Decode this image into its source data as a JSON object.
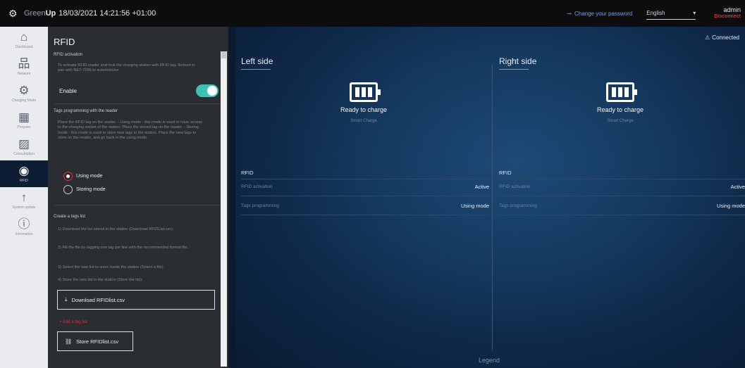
{
  "topbar": {
    "brand_prefix": "Green",
    "brand_bold": "Up",
    "datetime": "18/03/2021 14:21:56 +01:00",
    "change_password": "Change your password",
    "language": "English",
    "user": "admin",
    "logout": "Disconnect"
  },
  "nav": {
    "items": [
      {
        "label": "Dashboard",
        "icon": "home-icon"
      },
      {
        "label": "Network",
        "icon": "network-icon"
      },
      {
        "label": "Charging Mode",
        "icon": "gear-icon"
      },
      {
        "label": "Program",
        "icon": "calendar-icon"
      },
      {
        "label": "Consumption",
        "icon": "chart-icon"
      },
      {
        "label": "RFID",
        "icon": "rfid-badge-icon"
      },
      {
        "label": "System update",
        "icon": "arrow-up-icon"
      },
      {
        "label": "Information",
        "icon": "info-icon"
      }
    ]
  },
  "panel": {
    "title": "RFID",
    "activation": {
      "title": "RFID activation",
      "text": "To activate RFID reader and lock the charging station with RFID tag. Reboot to pair with NET-7596 to autodetector",
      "enable_label": "Enable"
    },
    "programming": {
      "title": "Tags programming with the reader",
      "text": "Place the RFID tag on the reader. - Using mode : this mode is used to have access to the charging socket of the station. Place the stored tag on the reader. - Storing mode : this mode is used to store new tags in the station. Place the new tags to store on the reader, and go back in the using mode.",
      "using_mode": "Using mode",
      "storing_mode": "Storing mode"
    },
    "tags_list": {
      "title": "Create a tags list",
      "step1": "1) Download the list stored in the station (Download RFIDList.csv).",
      "step2": "2) Fill the file by tagging one tag per line with the recommended format file.",
      "step3": "3) Select the new list to store inside the station (Select a file).",
      "step4": "4) Store the new list in the station (Store the list).",
      "download_btn": "Download RFIDlist.csv",
      "add_link": "+ Add a tag list",
      "store_btn": "Store RFIDlist.csv"
    }
  },
  "main": {
    "connected": "Connected",
    "left": {
      "title": "Left side",
      "status": "Ready to charge",
      "substatus": "Smart Charge",
      "rfid_heading": "RFID",
      "row1_label": "RFID activation",
      "row1_value": "Active",
      "row2_label": "Tags programming",
      "row2_value": "Using mode"
    },
    "right": {
      "title": "Right side",
      "status": "Ready to charge",
      "substatus": "Smart Charge",
      "rfid_heading": "RFID",
      "row1_label": "RFID activation",
      "row1_value": "Active",
      "row2_label": "Tags programming",
      "row2_value": "Using mode"
    },
    "legend": "Legend"
  },
  "colors": {
    "accent_red": "#e0303a",
    "toggle_teal": "#3cc2b0",
    "link_blue": "#6fa0e8"
  }
}
